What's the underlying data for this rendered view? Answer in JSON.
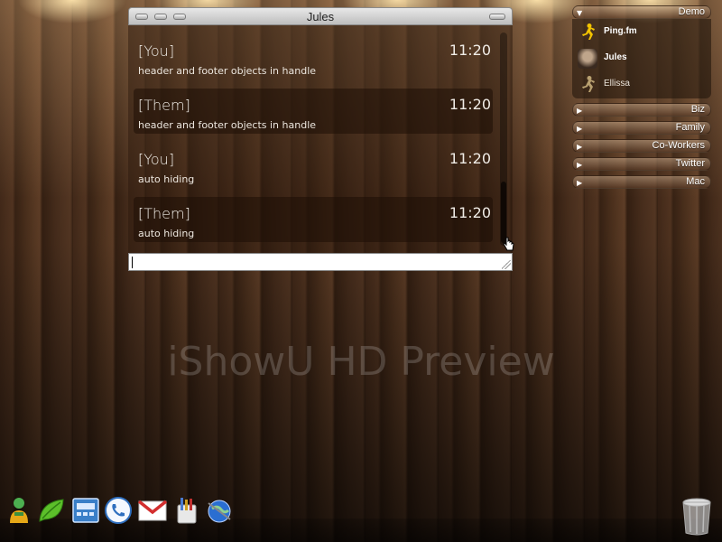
{
  "chat_window": {
    "title": "Jules",
    "messages": [
      {
        "sender": "[You]",
        "time": "11:20",
        "text": "header and footer objects in handle"
      },
      {
        "sender": "[Them]",
        "time": "11:20",
        "text": "header and footer objects in handle"
      },
      {
        "sender": "[You]",
        "time": "11:20",
        "text": "auto hiding"
      },
      {
        "sender": "[Them]",
        "time": "11:20",
        "text": "auto hiding"
      }
    ],
    "input": {
      "value": ""
    }
  },
  "buddy_list": {
    "groups": [
      {
        "name": "Demo",
        "expanded": true,
        "buddies": [
          {
            "name": "Ping.fm",
            "icon": "aim-runner-icon"
          },
          {
            "name": "Jules",
            "icon": "avatar-photo-icon"
          },
          {
            "name": "Ellissa",
            "icon": "aim-runner-dim-icon"
          }
        ]
      },
      {
        "name": "Biz",
        "expanded": false
      },
      {
        "name": "Family",
        "expanded": false
      },
      {
        "name": "Co-Workers",
        "expanded": false
      },
      {
        "name": "Twitter",
        "expanded": false
      },
      {
        "name": "Mac",
        "expanded": false
      }
    ]
  },
  "watermark": "iShowU HD Preview",
  "dock": {
    "items": [
      {
        "icon": "messenger-buddy-icon"
      },
      {
        "icon": "leaf-icon"
      },
      {
        "icon": "calculator-icon"
      },
      {
        "icon": "phone-icon"
      },
      {
        "icon": "gmail-icon"
      },
      {
        "icon": "notes-icon"
      },
      {
        "icon": "globe-icon"
      },
      {
        "icon": "trash-icon"
      }
    ]
  }
}
